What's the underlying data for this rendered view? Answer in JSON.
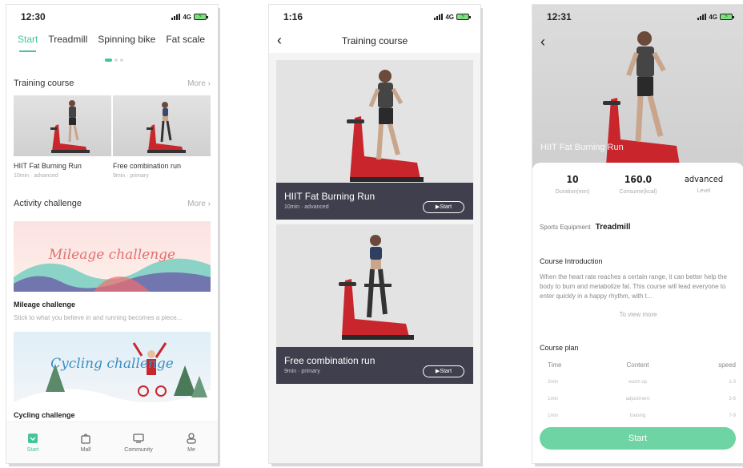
{
  "phone1": {
    "status": {
      "time": "12:30",
      "network": "4G"
    },
    "tabs": [
      "Start",
      "Treadmill",
      "Spinning bike",
      "Fat scale"
    ],
    "training": {
      "heading": "Training course",
      "more": "More",
      "courses": [
        {
          "title": "HIIT Fat Burning Run",
          "sub": "10min · advanced"
        },
        {
          "title": "Free combination run",
          "sub": "9min · primary"
        }
      ]
    },
    "activity": {
      "heading": "Activity challenge",
      "more": "More",
      "items": [
        {
          "banner_text": "Mileage challenge",
          "title": "Mileage challenge",
          "desc": "Stick to what you believe in and running becomes a piece..."
        },
        {
          "banner_text": "Cycling challenge",
          "title": "Cycling challenge"
        }
      ]
    },
    "tabbar": [
      "Start",
      "Mall",
      "Community",
      "Me"
    ]
  },
  "phone2": {
    "status": {
      "time": "1:16",
      "network": "4G"
    },
    "title": "Training course",
    "cards": [
      {
        "title": "HIIT Fat Burning Run",
        "sub": "10min · advanced",
        "button": "Start"
      },
      {
        "title": "Free combination run",
        "sub": "9min · primary",
        "button": "Start"
      }
    ]
  },
  "phone3": {
    "status": {
      "time": "12:31",
      "network": "4G"
    },
    "hero_title": "HIIT Fat Burning Run",
    "stats": [
      {
        "value": "10",
        "label": "Duration(min)"
      },
      {
        "value": "160.0",
        "label": "Consume(kcal)"
      },
      {
        "value": "advanced",
        "label": "Level"
      }
    ],
    "equipment_label": "Sports Equipment",
    "equipment_value": "Treadmill",
    "intro_heading": "Course Introduction",
    "intro_text": "When the heart rate reaches a certain range, it can better help the body to burn and metabolize fat. This course will lead everyone to enter quickly in a happy rhythm, with t...",
    "view_more": "To view more",
    "plan_heading": "Course plan",
    "plan_columns": [
      "Time",
      "Content",
      "speed"
    ],
    "plan_rows": [
      [
        "2min",
        "warm up",
        "1-3"
      ],
      [
        "1min",
        "adjustment",
        "3-6"
      ],
      [
        "1min",
        "training",
        "7-9"
      ]
    ],
    "start_button": "Start"
  },
  "colors": {
    "accent": "#43c49a",
    "start_button": "#6fd4a3",
    "card_bar": "#3f3f4e",
    "treadmill_red": "#c8262c"
  }
}
